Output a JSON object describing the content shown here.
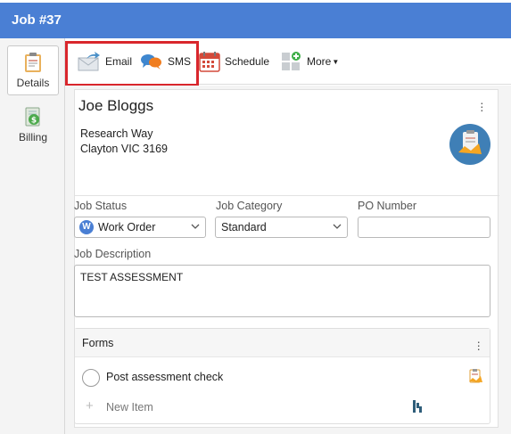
{
  "window": {
    "title": "Job #37"
  },
  "sidebar": {
    "items": [
      {
        "label": "Details",
        "icon": "details-clipboard-icon",
        "active": true
      },
      {
        "label": "Billing",
        "icon": "billing-dollar-icon",
        "active": false
      }
    ]
  },
  "toolbar": {
    "email_label": "Email",
    "sms_label": "SMS",
    "schedule_label": "Schedule",
    "more_label": "More"
  },
  "customer": {
    "name": "Joe Bloggs",
    "address_line1": "Research Way",
    "address_line2": "Clayton VIC 3169"
  },
  "fields": {
    "job_status_label": "Job Status",
    "job_status_value": "Work Order",
    "job_status_badge": "W",
    "job_category_label": "Job Category",
    "job_category_value": "Standard",
    "po_number_label": "PO Number",
    "po_number_value": "",
    "job_description_label": "Job Description",
    "job_description_value": "TEST ASSESSMENT"
  },
  "forms": {
    "title": "Forms",
    "items": [
      {
        "label": "Post assessment check"
      }
    ],
    "new_item_label": "New Item"
  },
  "colors": {
    "titlebar": "#4a7fd4",
    "highlight": "#d9262c",
    "status_badge": "#4a7fd4"
  }
}
